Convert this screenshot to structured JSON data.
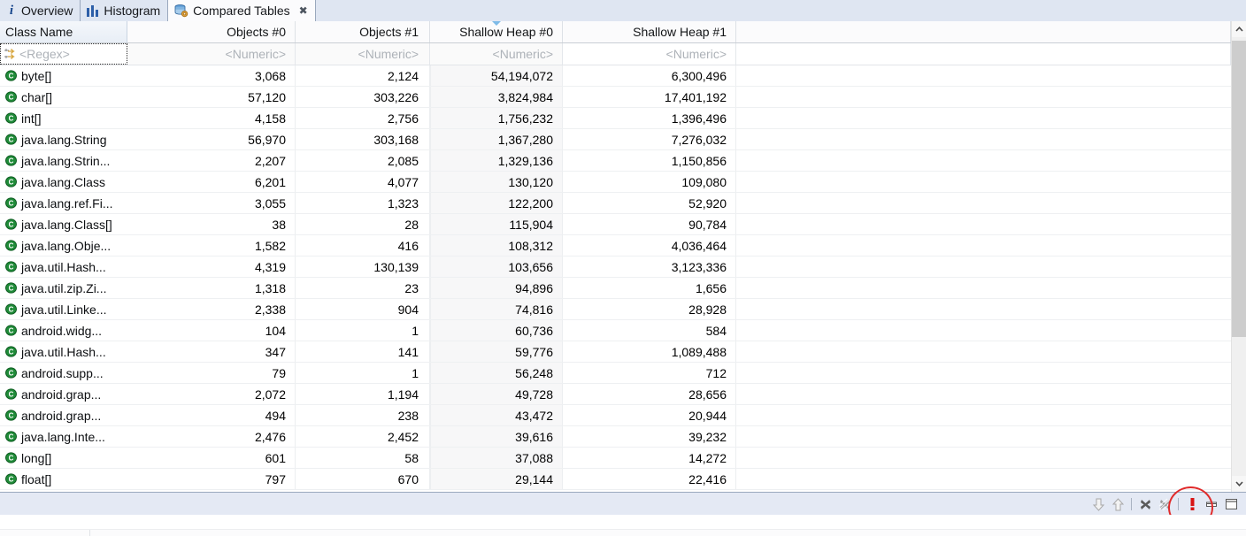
{
  "window": {
    "accent_color": "#17468c",
    "annotation_color": "#e02b2b"
  },
  "tabs": [
    {
      "label": "Overview",
      "icon": "info-icon",
      "active": false,
      "closable": false
    },
    {
      "label": "Histogram",
      "icon": "histogram-icon",
      "active": false,
      "closable": false
    },
    {
      "label": "Compared Tables",
      "icon": "compared-tables-icon",
      "active": true,
      "closable": true,
      "close_glyph": "✖"
    }
  ],
  "table": {
    "columns": [
      {
        "label": "Class Name",
        "align": "left",
        "sorted": false,
        "focused": true
      },
      {
        "label": "Objects #0",
        "align": "right",
        "sorted": false,
        "focused": false
      },
      {
        "label": "Objects #1",
        "align": "right",
        "sorted": false,
        "focused": false
      },
      {
        "label": "Shallow Heap #0",
        "align": "right",
        "sorted": true,
        "sort_direction": "desc",
        "focused": false
      },
      {
        "label": "Shallow Heap #1",
        "align": "right",
        "sorted": false,
        "focused": false
      }
    ],
    "filter_row": {
      "class_name": "<Regex>",
      "objects_0": "<Numeric>",
      "objects_1": "<Numeric>",
      "shallow_heap_0": "<Numeric>",
      "shallow_heap_1": "<Numeric>",
      "regex_icon": "regex-filter-icon"
    },
    "rows": [
      {
        "icon": "class-icon",
        "class_name": "byte[]",
        "objects_0": "3,068",
        "objects_1": "2,124",
        "shallow_heap_0": "54,194,072",
        "shallow_heap_1": "6,300,496"
      },
      {
        "icon": "class-icon",
        "class_name": "char[]",
        "objects_0": "57,120",
        "objects_1": "303,226",
        "shallow_heap_0": "3,824,984",
        "shallow_heap_1": "17,401,192"
      },
      {
        "icon": "class-icon",
        "class_name": "int[]",
        "objects_0": "4,158",
        "objects_1": "2,756",
        "shallow_heap_0": "1,756,232",
        "shallow_heap_1": "1,396,496"
      },
      {
        "icon": "class-icon",
        "class_name": "java.lang.String",
        "objects_0": "56,970",
        "objects_1": "303,168",
        "shallow_heap_0": "1,367,280",
        "shallow_heap_1": "7,276,032"
      },
      {
        "icon": "class-icon",
        "class_name": "java.lang.Strin...",
        "objects_0": "2,207",
        "objects_1": "2,085",
        "shallow_heap_0": "1,329,136",
        "shallow_heap_1": "1,150,856"
      },
      {
        "icon": "class-icon",
        "class_name": "java.lang.Class",
        "objects_0": "6,201",
        "objects_1": "4,077",
        "shallow_heap_0": "130,120",
        "shallow_heap_1": "109,080"
      },
      {
        "icon": "class-icon",
        "class_name": "java.lang.ref.Fi...",
        "objects_0": "3,055",
        "objects_1": "1,323",
        "shallow_heap_0": "122,200",
        "shallow_heap_1": "52,920"
      },
      {
        "icon": "class-icon",
        "class_name": "java.lang.Class[]",
        "objects_0": "38",
        "objects_1": "28",
        "shallow_heap_0": "115,904",
        "shallow_heap_1": "90,784"
      },
      {
        "icon": "class-icon",
        "class_name": "java.lang.Obje...",
        "objects_0": "1,582",
        "objects_1": "416",
        "shallow_heap_0": "108,312",
        "shallow_heap_1": "4,036,464"
      },
      {
        "icon": "class-icon",
        "class_name": "java.util.Hash...",
        "objects_0": "4,319",
        "objects_1": "130,139",
        "shallow_heap_0": "103,656",
        "shallow_heap_1": "3,123,336"
      },
      {
        "icon": "class-icon",
        "class_name": "java.util.zip.Zi...",
        "objects_0": "1,318",
        "objects_1": "23",
        "shallow_heap_0": "94,896",
        "shallow_heap_1": "1,656"
      },
      {
        "icon": "class-icon",
        "class_name": "java.util.Linke...",
        "objects_0": "2,338",
        "objects_1": "904",
        "shallow_heap_0": "74,816",
        "shallow_heap_1": "28,928"
      },
      {
        "icon": "class-icon",
        "class_name": "android.widg...",
        "objects_0": "104",
        "objects_1": "1",
        "shallow_heap_0": "60,736",
        "shallow_heap_1": "584"
      },
      {
        "icon": "class-icon",
        "class_name": "java.util.Hash...",
        "objects_0": "347",
        "objects_1": "141",
        "shallow_heap_0": "59,776",
        "shallow_heap_1": "1,089,488"
      },
      {
        "icon": "class-icon",
        "class_name": "android.supp...",
        "objects_0": "79",
        "objects_1": "1",
        "shallow_heap_0": "56,248",
        "shallow_heap_1": "712"
      },
      {
        "icon": "class-icon",
        "class_name": "android.grap...",
        "objects_0": "2,072",
        "objects_1": "1,194",
        "shallow_heap_0": "49,728",
        "shallow_heap_1": "28,656"
      },
      {
        "icon": "class-icon",
        "class_name": "android.grap...",
        "objects_0": "494",
        "objects_1": "238",
        "shallow_heap_0": "43,472",
        "shallow_heap_1": "20,944"
      },
      {
        "icon": "class-icon",
        "class_name": "java.lang.Inte...",
        "objects_0": "2,476",
        "objects_1": "2,452",
        "shallow_heap_0": "39,616",
        "shallow_heap_1": "39,232"
      },
      {
        "icon": "class-icon",
        "class_name": "long[]",
        "objects_0": "601",
        "objects_1": "58",
        "shallow_heap_0": "37,088",
        "shallow_heap_1": "14,272"
      },
      {
        "icon": "class-icon",
        "class_name": "float[]",
        "objects_0": "797",
        "objects_1": "670",
        "shallow_heap_0": "29,144",
        "shallow_heap_1": "22,416"
      }
    ]
  },
  "scrollbar": {
    "up_icon": "chevron-up-icon",
    "down_icon": "chevron-down-icon",
    "thumb_top_pct": 4,
    "thumb_height_pct": 63
  },
  "bottom_toolbar": {
    "buttons": [
      {
        "name": "scroll-down-button",
        "icon": "arrow-down-icon",
        "enabled": false
      },
      {
        "name": "scroll-up-button",
        "icon": "arrow-up-icon",
        "enabled": false
      },
      {
        "name": "separator-1",
        "icon": "separator",
        "enabled": false
      },
      {
        "name": "delete-button",
        "icon": "x-mark-icon",
        "enabled": true
      },
      {
        "name": "delete-all-button",
        "icon": "x-mark-disabled-icon",
        "enabled": false
      },
      {
        "name": "separator-2",
        "icon": "separator",
        "enabled": false
      },
      {
        "name": "errors-button",
        "icon": "error-exclamation-icon",
        "enabled": true
      },
      {
        "name": "minimize-button",
        "icon": "minimize-icon",
        "enabled": true
      },
      {
        "name": "maximize-button",
        "icon": "maximize-icon",
        "enabled": true
      }
    ]
  }
}
